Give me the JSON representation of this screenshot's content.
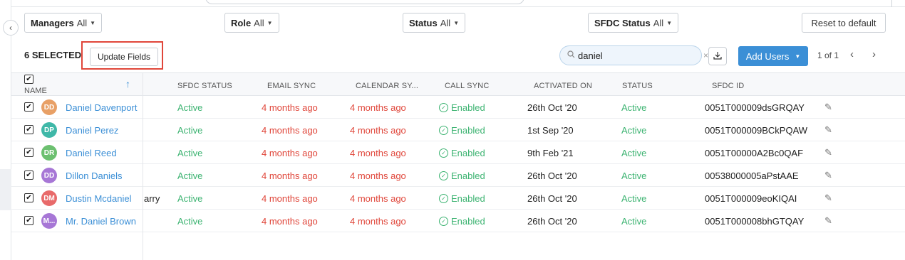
{
  "filters": {
    "managers": {
      "label": "Managers",
      "value": "All"
    },
    "role": {
      "label": "Role",
      "value": "All"
    },
    "status": {
      "label": "Status",
      "value": "All"
    },
    "sfdc_status": {
      "label": "SFDC Status",
      "value": "All"
    }
  },
  "reset_label": "Reset to default",
  "toolbar": {
    "selected_count": "6 SELECTED",
    "update_fields_label": "Update Fields",
    "search_value": "daniel",
    "add_users_label": "Add Users",
    "pagination": "1 of 1"
  },
  "columns": [
    "NAME",
    "SFDC STATUS",
    "EMAIL SYNC",
    "CALENDAR SY...",
    "CALL SYNC",
    "ACTIVATED ON",
    "STATUS",
    "SFDC ID"
  ],
  "rows": [
    {
      "initials": "DD",
      "avatar_color": "#e8a066",
      "name": "Daniel Davenport",
      "sfdc_status": "Active",
      "email_sync": "4 months ago",
      "calendar_sync": "4 months ago",
      "call_sync": "Enabled",
      "activated_on": "26th Oct '20",
      "status": "Active",
      "sfdc_id": "0051T000009dsGRQAY"
    },
    {
      "initials": "DP",
      "avatar_color": "#3fb8a8",
      "name": "Daniel Perez",
      "sfdc_status": "Active",
      "email_sync": "4 months ago",
      "calendar_sync": "4 months ago",
      "call_sync": "Enabled",
      "activated_on": "1st Sep '20",
      "status": "Active",
      "sfdc_id": "0051T000009BCkPQAW"
    },
    {
      "initials": "DR",
      "avatar_color": "#6cc070",
      "name": "Daniel Reed",
      "sfdc_status": "Active",
      "email_sync": "4 months ago",
      "calendar_sync": "4 months ago",
      "call_sync": "Enabled",
      "activated_on": "9th Feb '21",
      "status": "Active",
      "sfdc_id": "0051T00000A2Bc0QAF"
    },
    {
      "initials": "DD",
      "avatar_color": "#a777d6",
      "name": "Dillon Daniels",
      "sfdc_status": "Active",
      "email_sync": "4 months ago",
      "calendar_sync": "4 months ago",
      "call_sync": "Enabled",
      "activated_on": "26th Oct '20",
      "status": "Active",
      "sfdc_id": "00538000005aPstAAE"
    },
    {
      "initials": "DM",
      "avatar_color": "#e86a6a",
      "name": "Dustin Mcdaniel",
      "overflow": "arry",
      "sfdc_status": "Active",
      "email_sync": "4 months ago",
      "calendar_sync": "4 months ago",
      "call_sync": "Enabled",
      "activated_on": "26th Oct '20",
      "status": "Active",
      "sfdc_id": "0051T000009eoKIQAI"
    },
    {
      "initials": "M...",
      "avatar_color": "#a777d6",
      "name": "Mr. Daniel Brown",
      "sfdc_status": "Active",
      "email_sync": "4 months ago",
      "calendar_sync": "4 months ago",
      "call_sync": "Enabled",
      "activated_on": "26th Oct '20",
      "status": "Active",
      "sfdc_id": "0051T000008bhGTQAY"
    }
  ],
  "colors": {
    "accent": "#3b8fd6",
    "active": "#3cb371",
    "recent": "#e0463a",
    "highlight": "#e0463a"
  }
}
